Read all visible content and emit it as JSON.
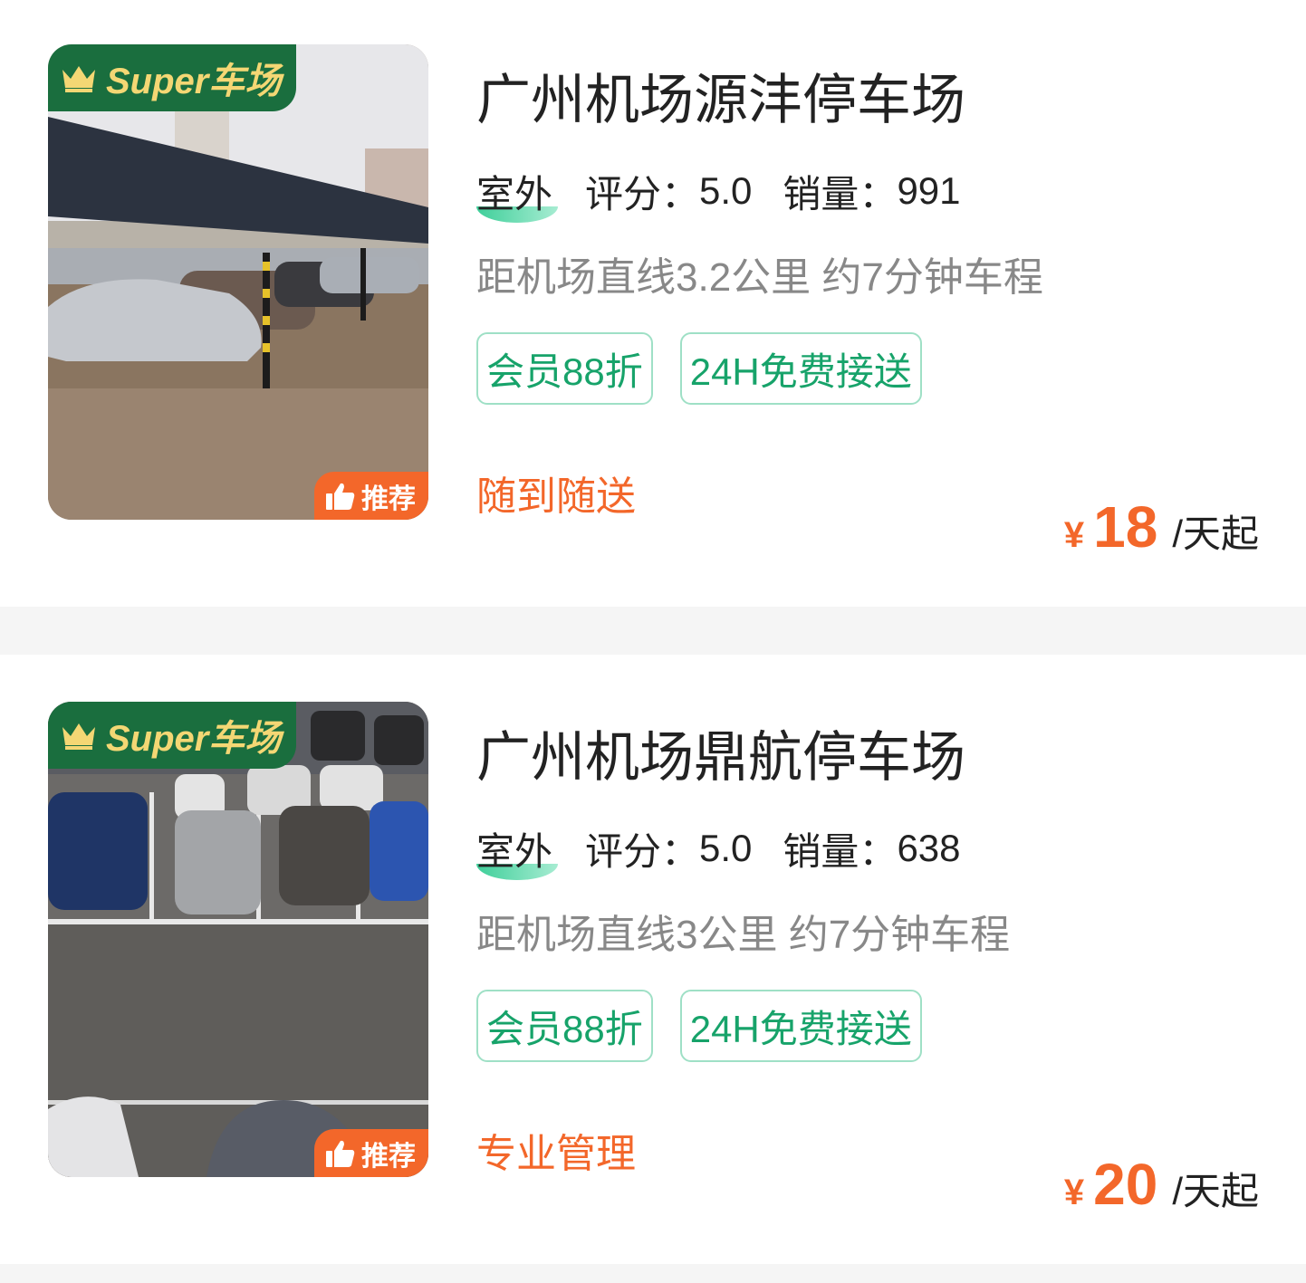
{
  "listings": [
    {
      "super_badge": "Super车场",
      "recommend_badge": "推荐",
      "name": "广州机场源沣停车场",
      "type": "室外",
      "rating_label": "评分：",
      "rating": "5.0",
      "sales_label": "销量：",
      "sales": "991",
      "distance": "距机场直线3.2公里 约7分钟车程",
      "tags": [
        "会员88折",
        "24H免费接送"
      ],
      "slogan": "随到随送",
      "currency": "¥",
      "price": "18",
      "price_unit": "/天起"
    },
    {
      "super_badge": "Super车场",
      "recommend_badge": "推荐",
      "name": "广州机场鼎航停车场",
      "type": "室外",
      "rating_label": "评分：",
      "rating": "5.0",
      "sales_label": "销量：",
      "sales": "638",
      "distance": "距机场直线3公里 约7分钟车程",
      "tags": [
        "会员88折",
        "24H免费接送"
      ],
      "slogan": "专业管理",
      "currency": "¥",
      "price": "20",
      "price_unit": "/天起"
    }
  ],
  "colors": {
    "accent_orange": "#f3672a",
    "tag_green": "#17a36a",
    "badge_green": "#1a6e3e",
    "badge_gold": "#f4d774"
  }
}
